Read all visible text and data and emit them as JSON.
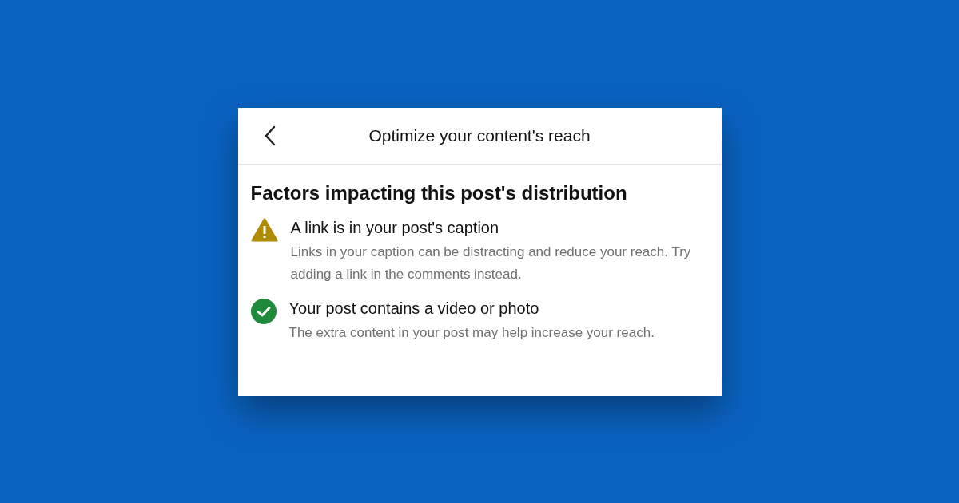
{
  "header": {
    "title": "Optimize your content's reach"
  },
  "section": {
    "heading": "Factors impacting this post's distribution"
  },
  "factors": [
    {
      "kind": "warning",
      "title": "A link is in your post's caption",
      "description": "Links in your caption can be distracting and reduce your reach. Try adding a link in the comments instead."
    },
    {
      "kind": "success",
      "title": "Your post contains a video or photo",
      "description": "The extra content in your post may help increase your reach."
    }
  ]
}
